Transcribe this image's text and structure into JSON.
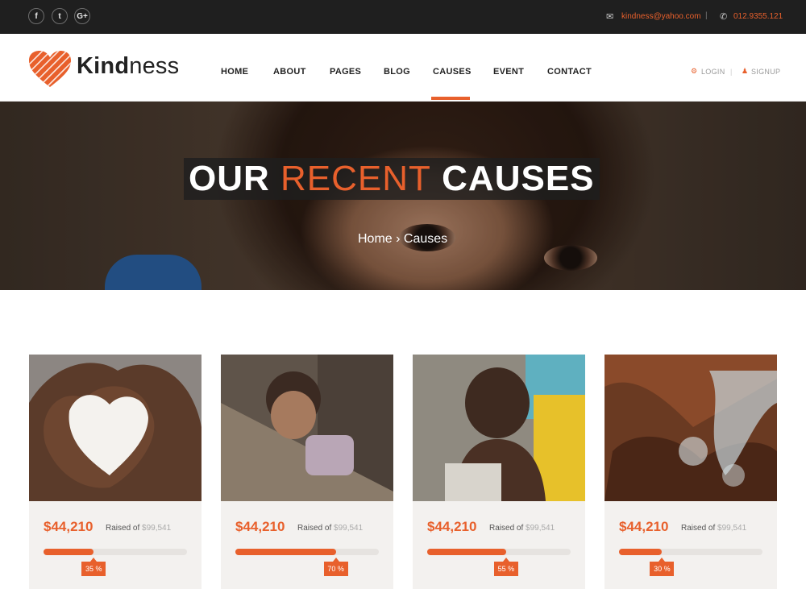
{
  "topbar": {
    "social": [
      {
        "name": "facebook-icon",
        "glyph": "f"
      },
      {
        "name": "twitter-icon",
        "glyph": "t"
      },
      {
        "name": "google-plus-icon",
        "glyph": "G+"
      }
    ],
    "email": "kindness@yahoo.com",
    "phone": "012.9355.121",
    "email_icon": "envelope-icon",
    "phone_icon": "phone-icon"
  },
  "header": {
    "logo_bold": "Kind",
    "logo_light": "ness",
    "nav": [
      "HOME",
      "ABOUT",
      "PAGES",
      "BLOG",
      "CAUSES",
      "EVENT",
      "CONTACT"
    ],
    "active_nav": "CAUSES",
    "login": "LOGIN",
    "signup": "SIGNUP",
    "accent_color": "#e8602c"
  },
  "hero": {
    "title_1": "OUR",
    "title_2": "RECENT",
    "title_3": "CAUSES",
    "crumb": "Home › Causes"
  },
  "causes": [
    {
      "raised": "$44,210",
      "raised_label": "Raised of",
      "goal": "$99,541",
      "percent": 35,
      "percent_label": "35 %"
    },
    {
      "raised": "$44,210",
      "raised_label": "Raised of",
      "goal": "$99,541",
      "percent": 70,
      "percent_label": "70 %"
    },
    {
      "raised": "$44,210",
      "raised_label": "Raised of",
      "goal": "$99,541",
      "percent": 55,
      "percent_label": "55 %"
    },
    {
      "raised": "$44,210",
      "raised_label": "Raised of",
      "goal": "$99,541",
      "percent": 30,
      "percent_label": "30 %"
    }
  ]
}
